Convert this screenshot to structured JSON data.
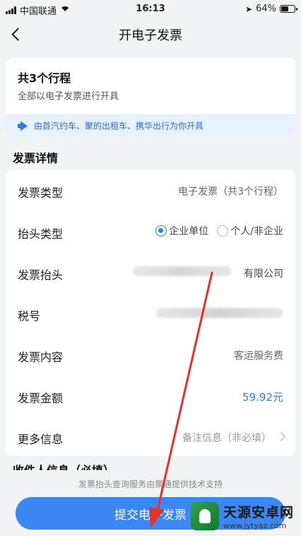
{
  "status_bar": {
    "carrier": "中国联通",
    "time": "16:13",
    "battery": "64%",
    "battery_level": 0.64
  },
  "nav": {
    "title": "开电子发票",
    "back_icon": "chevron-left-icon"
  },
  "summary": {
    "title": "共3个行程",
    "subtitle": "全部以电子发票进行开具",
    "notice_icon": "megaphone-icon",
    "notice": "由首汽约车、聚的出租车、携华出行为你开具"
  },
  "details": {
    "section_title": "发票详情",
    "rows": [
      {
        "label": "发票类型",
        "value": "电子发票（共3个行程）"
      },
      {
        "label": "抬头类型",
        "options": [
          "企业单位",
          "个人/非企业"
        ],
        "selected": "企业单位"
      },
      {
        "label": "发票抬头",
        "value_visible": "有限公司"
      },
      {
        "label": "税号"
      },
      {
        "label": "发票内容",
        "value": "客运服务费"
      },
      {
        "label": "发票金额",
        "value": "59.92元"
      },
      {
        "label": "更多信息",
        "value": "备注信息（非必填）"
      }
    ]
  },
  "recipient_peek": "收件人信息（必填）",
  "footer": {
    "note": "发票抬头查询服务由票通提供技术支持",
    "submit": "提交电子发票"
  },
  "colors": {
    "accent": "#2e7af0",
    "button": "#3d86f5",
    "annotation_arrow": "#e8302a"
  },
  "watermark": {
    "name": "天源安卓网",
    "url": "www.jytyaz.com"
  }
}
